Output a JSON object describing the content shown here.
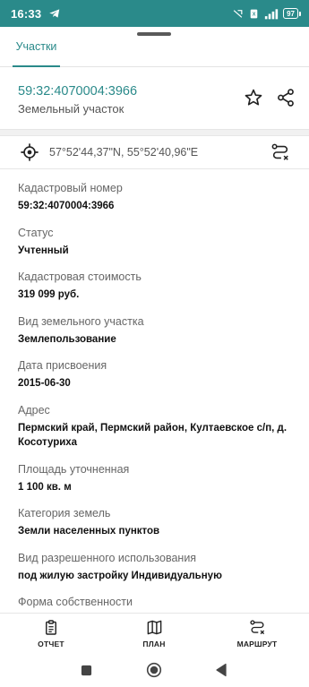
{
  "status_bar": {
    "time": "16:33",
    "battery": "97"
  },
  "tabs": [
    {
      "label": "Участки",
      "active": true
    }
  ],
  "parcel": {
    "number": "59:32:4070004:3966",
    "type": "Земельный участок"
  },
  "coordinates": "57°52'44,37\"N, 55°52'40,96\"E",
  "properties": [
    {
      "label": "Кадастровый номер",
      "value": "59:32:4070004:3966"
    },
    {
      "label": "Статус",
      "value": "Учтенный"
    },
    {
      "label": "Кадастровая стоимость",
      "value": "319 099 руб."
    },
    {
      "label": "Вид земельного участка",
      "value": "Землепользование"
    },
    {
      "label": "Дата присвоения",
      "value": "2015-06-30"
    },
    {
      "label": "Адрес",
      "value": "Пермский край, Пермский район, Култаевское с/п, д. Косотуриха"
    },
    {
      "label": "Площадь уточненная",
      "value": "1 100 кв. м"
    },
    {
      "label": "Категория земель",
      "value": "Земли населенных пунктов"
    },
    {
      "label": "Вид разрешенного использования",
      "value": "под жилую застройку Индивидуальную"
    },
    {
      "label": "Форма собственности",
      "value": ""
    }
  ],
  "bottom_nav": {
    "report": "ОТЧЕТ",
    "plan": "ПЛАН",
    "route": "МАРШРУТ"
  },
  "colors": {
    "accent": "#2a8a8a",
    "text": "#222222",
    "label": "#666666"
  },
  "icons": [
    "telegram-icon",
    "alarm-icon",
    "vibrate-icon",
    "signal-icon",
    "battery-icon",
    "star-icon",
    "share-icon",
    "gps-target-icon",
    "route-icon",
    "report-icon",
    "map-icon"
  ]
}
